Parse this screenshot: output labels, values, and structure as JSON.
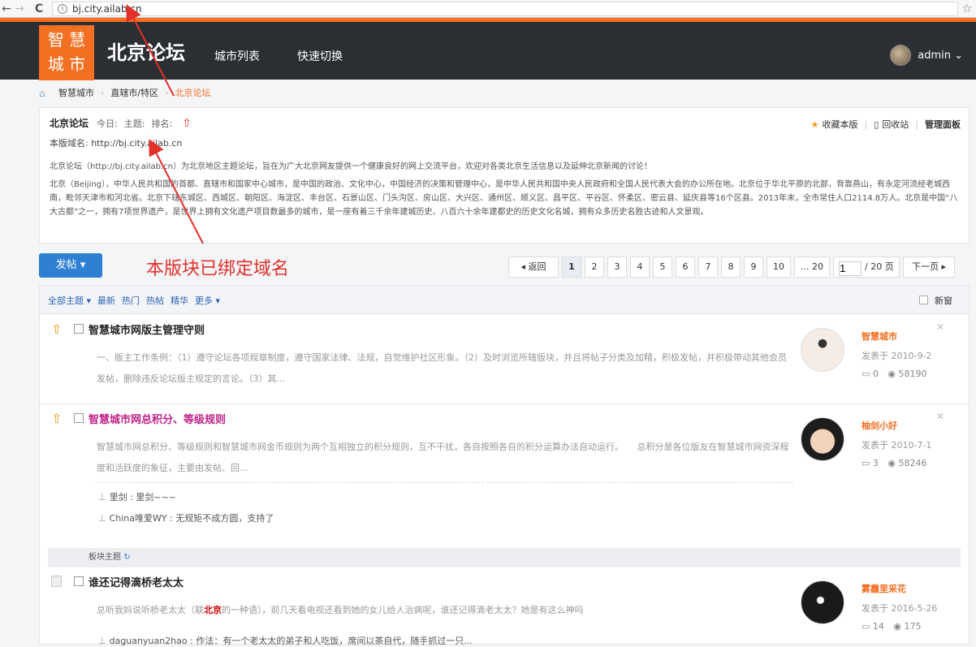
{
  "browser": {
    "url": "bj.city.ailab.cn",
    "back_icon": "←",
    "forward_icon": "→",
    "reload_icon": "C",
    "info_icon": "i",
    "star_icon": "☆"
  },
  "header": {
    "logo_line1": "智 慧",
    "logo_line2": "城 市",
    "site_title": "北京论坛",
    "nav": [
      "城市列表",
      "快速切换"
    ],
    "user_name": "admin ⌄"
  },
  "breadcrumb": {
    "home_icon": "⌂",
    "items": [
      "智慧城市",
      "直辖市/特区",
      "北京论坛"
    ],
    "separator": "›"
  },
  "forum": {
    "name": "北京论坛",
    "today_label": "今日:",
    "topics_label": "主题:",
    "rank_label": "排名:",
    "rank_icon": "⇧",
    "actions": [
      "收藏本版",
      "回收站",
      "管理面板"
    ],
    "domain_text": "本版域名: http://bj.city.ailab.cn",
    "desc_intro": "北京论坛（http://bj.city.ailab.cn）为北京地区主题论坛，旨在为广大北京网友提供一个健康良好的网上交流平台，欢迎对各类北京生活信息以及延伸北京新闻的讨论！",
    "desc_long": "北京（Beijing），中华人民共和国的首都、直辖市和国家中心城市，是中国的政治、文化中心，中国经济的决策和管理中心，是中华人民共和国中央人民政府和全国人民代表大会的办公所在地。北京位于华北平原的北部，背靠燕山，有永定河流经老城西南，毗邻天津市和河北省。北京下辖东城区、西城区、朝阳区、海淀区、丰台区、石景山区、门头沟区、房山区、大兴区、通州区、顺义区、昌平区、平谷区、怀柔区、密云县、延庆县等16个区县。2013年末，全市常住人口2114.8万人。北京是中国“八大古都”之一，拥有7项世界遗产，是世界上拥有文化遗产项目数最多的城市，是一座有着三千余年建城历史、八百六十余年建都史的历史文化名城，拥有众多历史名胜古迹和人文景观。"
  },
  "toolbar": {
    "post_label": "发帖 ▾",
    "annotation": "本版块已绑定域名"
  },
  "pager": {
    "prev": "◂ 返回",
    "pages": [
      "1",
      "2",
      "3",
      "4",
      "5",
      "6",
      "7",
      "8",
      "9",
      "10",
      "... 20"
    ],
    "total": "/ 20 页",
    "next": "下一页 ▸",
    "current": "1"
  },
  "filters": {
    "items": [
      "全部主题 ▾",
      "最新",
      "热门",
      "热帖",
      "精华",
      "更多 ▾"
    ],
    "new_window": "新窗"
  },
  "threads": [
    {
      "title": "智慧城市网版主管理守则",
      "summary": "一、版主工作条例：（1）遵守论坛各项规章制度，遵守国家法律、法规，自觉维护社区形象。（2）及时浏览所辖版块，并且将帖子分类及加精，积极发帖，并积极带动其他会员发帖，删除违反论坛版主规定的言论。（3）其...",
      "author": "智慧城市",
      "date": "发表于 2010-9-2",
      "replies": "0",
      "views": "58190"
    },
    {
      "title": "智慧城市网总积分、等级规则",
      "summary": "智慧城市网总积分、等级规则和智慧城市网金币规则为两个互相独立的积分规则，互不干扰，各自按照各自的积分运算办法自动运行。　　总积分是各位版友在智慧城市网资深程度和活跃度的象征，主要由发帖、回...",
      "author": "柚剑小好",
      "date": "发表于 2010-7-1",
      "replies": "3",
      "views": "58246",
      "replies_list": [
        {
          "user": "里剑",
          "text": "里剑~~~"
        },
        {
          "user": "China唯爱WY",
          "text": "无规矩不成方圆，支持了"
        }
      ]
    },
    {
      "title": "谁还记得滴桥老太太",
      "summary_pre": "总听我妈说听桥老太太（联",
      "summary_hl": "北京",
      "summary_post": "的一种语），前几天看电视还看到她的女儿给人治病呢，谁还记得滴老太太？她是有这么神吗",
      "author": "雾霾里采花",
      "date": "发表于 2016-5-26",
      "replies": "14",
      "views": "175",
      "reply_preview": {
        "user": "daguanyuan2hao",
        "text": "作法：有一个老太太的弟子和人吃饭，席间以茶自代，随手抓过一只..."
      }
    }
  ],
  "section_label": "板块主题",
  "section_icon": "↻",
  "icons": {
    "pin": "⇧",
    "reply_person": "⊥",
    "reply_count": "▭",
    "view_count": "◉",
    "close": "✕"
  },
  "colors": {
    "brand_orange": "#f36f21",
    "header_dark": "#2b2f33",
    "post_button": "#2f7fd3",
    "annotation_red": "#e2302b"
  }
}
